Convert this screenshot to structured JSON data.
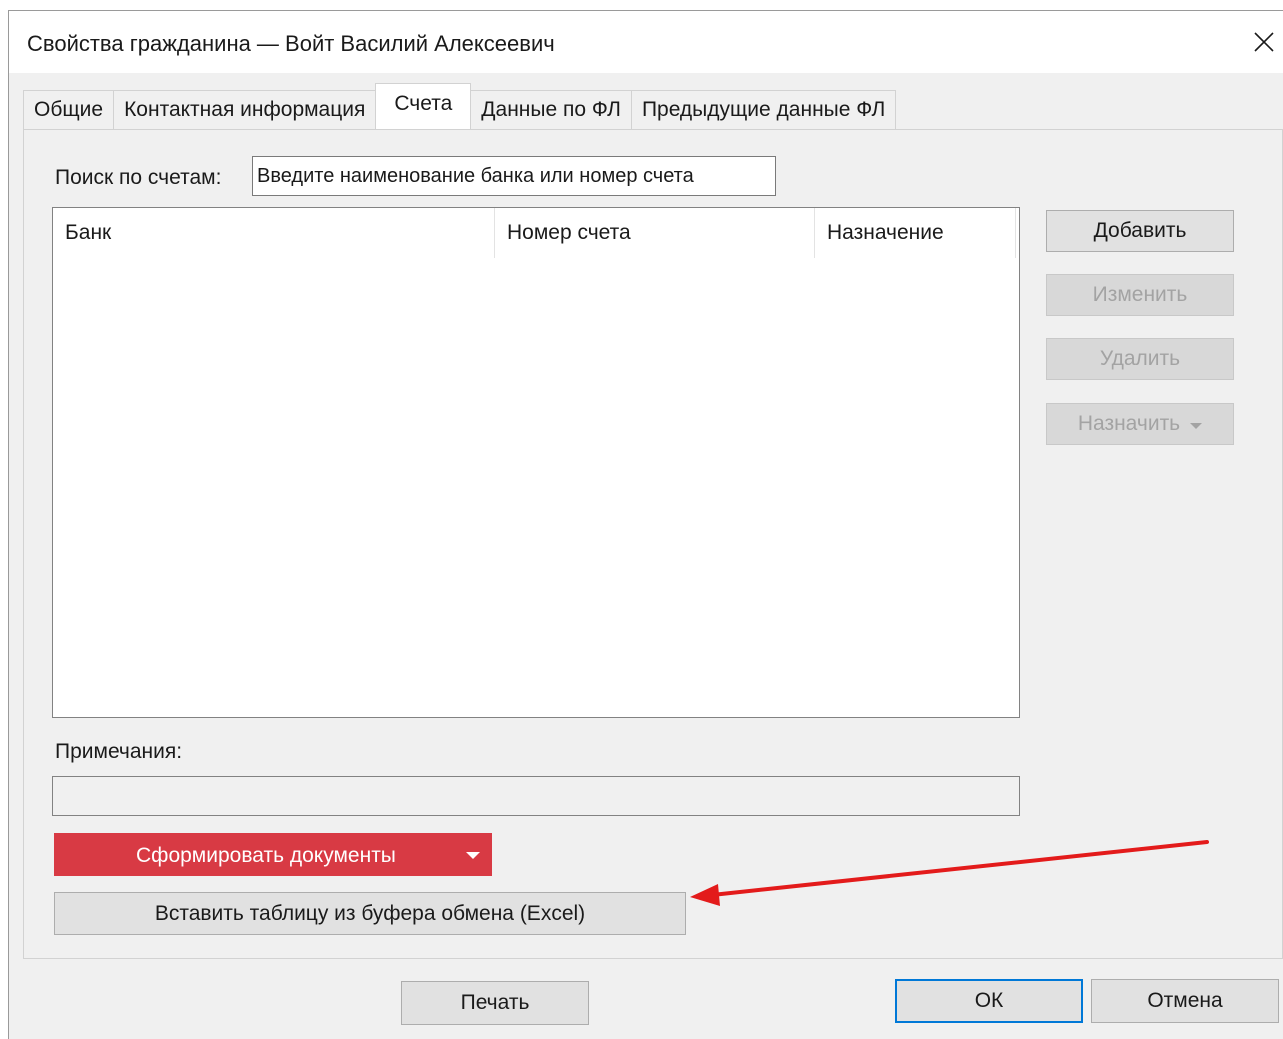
{
  "window": {
    "title": "Свойства гражданина — Войт Василий Алексеевич",
    "close_icon": "close-icon"
  },
  "tabs": [
    {
      "label": "Общие",
      "active": false
    },
    {
      "label": "Контактная информация",
      "active": false
    },
    {
      "label": "Счета",
      "active": true
    },
    {
      "label": "Данные по ФЛ",
      "active": false
    },
    {
      "label": "Предыдущие данные ФЛ",
      "active": false
    }
  ],
  "search": {
    "label": "Поиск по счетам:",
    "placeholder": "Введите наименование банка или номер счета",
    "value": ""
  },
  "table": {
    "columns": [
      "Банк",
      "Номер счета",
      "Назначение"
    ],
    "rows": []
  },
  "side_buttons": {
    "add": "Добавить",
    "edit": "Изменить",
    "delete": "Удалить",
    "assign": "Назначить"
  },
  "notes": {
    "label": "Примечания:",
    "value": ""
  },
  "actions": {
    "generate_docs": "Сформировать документы",
    "paste_table": "Вставить таблицу из буфера обмена (Excel)"
  },
  "footer": {
    "print": "Печать",
    "ok": "ОК",
    "cancel": "Отмена"
  },
  "colors": {
    "accent_red": "#d83a44",
    "annotation_arrow": "#e31b1b",
    "default_button_border": "#0078d7"
  }
}
